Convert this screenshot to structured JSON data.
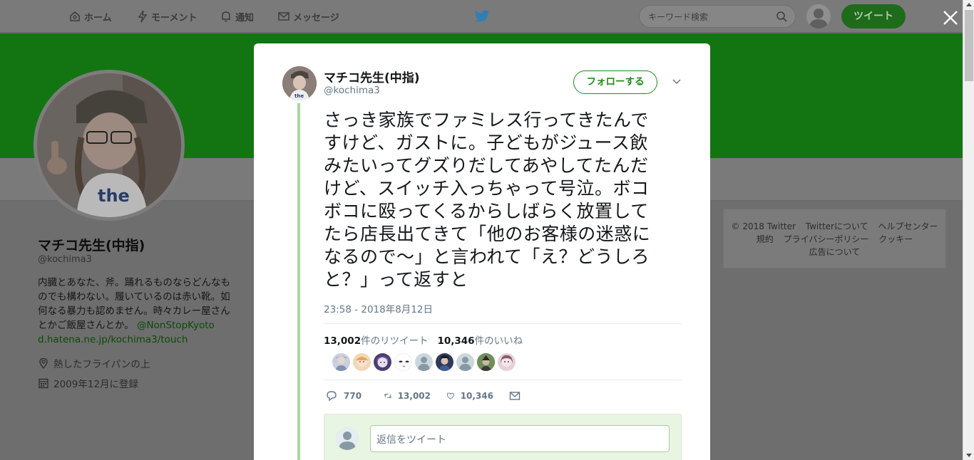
{
  "nav": {
    "home": "ホーム",
    "moments": "モーメント",
    "notifications": "通知",
    "messages": "メッセージ",
    "search_placeholder": "キーワード検索",
    "tweet_button": "ツイート"
  },
  "profile": {
    "name": "マチコ先生(中指)",
    "handle": "@kochima3",
    "bio_lines": [
      "内臓とあなた、斧。踊れるものならどんなも",
      "のでも構わない。履いているのは赤い靴。如",
      "何なる暴力も認めません。時々カレー屋さん"
    ],
    "bio_last_text": "とかご飯屋さんとか。",
    "bio_mention": "@NonStopKyoto",
    "bio_url": "d.hatena.ne.jp/kochima3/touch",
    "location": "熱したフライパンの上",
    "joined": "2009年12月に登録"
  },
  "footer": {
    "row1": [
      "© 2018 Twitter",
      "Twitterについて",
      "ヘルプセンター"
    ],
    "row2": [
      "規約",
      "プライバシーポリシー",
      "クッキー"
    ],
    "row3": [
      "広告について"
    ]
  },
  "tweet": {
    "author_name": "マチコ先生(中指)",
    "author_handle": "@kochima3",
    "follow_label": "フォローする",
    "text_lines": [
      "さっき家族でファミレス行ってきたんで",
      "すけど、ガストに。子どもがジュース飲",
      "みたいってグズりだしてあやしてたんだ",
      "けど、スイッチ入っちゃって号泣。ボコ",
      "ボコに殴ってくるからしばらく放置して",
      "たら店長出てきて「他のお客様の迷惑に",
      "なるので〜」と言われて「え？どうしろ",
      "と？」って返すと"
    ],
    "timestamp": "23:58 - 2018年8月12日",
    "retweets_count": "13,002",
    "retweets_label": "件のリツイート",
    "likes_count": "10,346",
    "likes_label": "件のいいね",
    "reply_count": "770",
    "retweet_action_count": "13,002",
    "like_action_count": "10,346",
    "reply_placeholder": "返信をツイート"
  },
  "colors": {
    "accent": "#23891b",
    "banner": "#127512",
    "thread_line": "#a9d69f"
  }
}
